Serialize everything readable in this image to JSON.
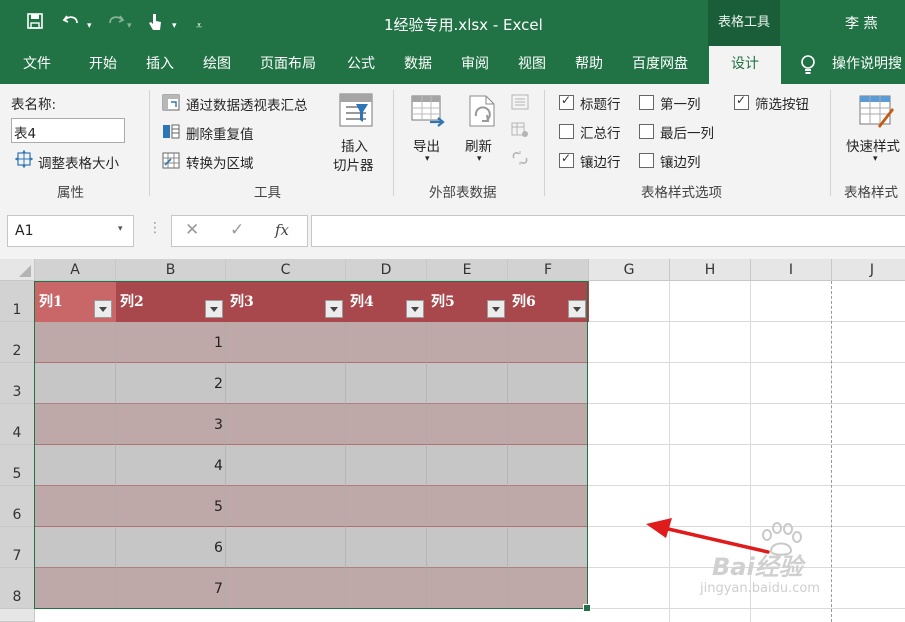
{
  "titlebar": {
    "filename_title": "1经验专用.xlsx  -  Excel",
    "context_tab": "表格工具",
    "user": "李 燕"
  },
  "tabs": [
    "文件",
    "开始",
    "插入",
    "绘图",
    "页面布局",
    "公式",
    "数据",
    "审阅",
    "视图",
    "帮助",
    "百度网盘",
    "设计"
  ],
  "active_tab": "设计",
  "tell_me": "操作说明搜",
  "ribbon": {
    "properties": {
      "table_name_label": "表名称:",
      "table_name_value": "表4",
      "resize": "调整表格大小",
      "group": "属性"
    },
    "tools": {
      "pivot": "通过数据透视表汇总",
      "remove_dup": "删除重复值",
      "convert": "转换为区域",
      "slicer_line1": "插入",
      "slicer_line2": "切片器",
      "group": "工具"
    },
    "external": {
      "export": "导出",
      "refresh": "刷新",
      "group": "外部表数据"
    },
    "style_options": {
      "header_row": "标题行",
      "total_row": "汇总行",
      "banded_rows": "镶边行",
      "first_col": "第一列",
      "last_col": "最后一列",
      "banded_cols": "镶边列",
      "filter_btn": "筛选按钮",
      "group": "表格样式选项"
    },
    "styles": {
      "quick": "快速样式",
      "group": "表格样式"
    }
  },
  "formula_bar": {
    "name_box": "A1",
    "fx": "fx"
  },
  "sheet": {
    "columns": [
      "A",
      "B",
      "C",
      "D",
      "E",
      "F",
      "G",
      "H",
      "I",
      "J"
    ],
    "rows": [
      "1",
      "2",
      "3",
      "4",
      "5",
      "6",
      "7",
      "8"
    ],
    "table_headers": [
      "列1",
      "列2",
      "列3",
      "列4",
      "列5",
      "列6"
    ],
    "values": [
      "1",
      "2",
      "3",
      "4",
      "5",
      "6",
      "7"
    ]
  },
  "watermark": {
    "brand": "Bai经验",
    "url": "jingyan.baidu.com"
  },
  "colors": {
    "excel_green": "#217346",
    "header_row": "#a8484c",
    "header_first": "#c86668",
    "band_dark": "#bfa8a8",
    "band_light": "#c6c6c6",
    "arrow": "#e01b1b"
  }
}
